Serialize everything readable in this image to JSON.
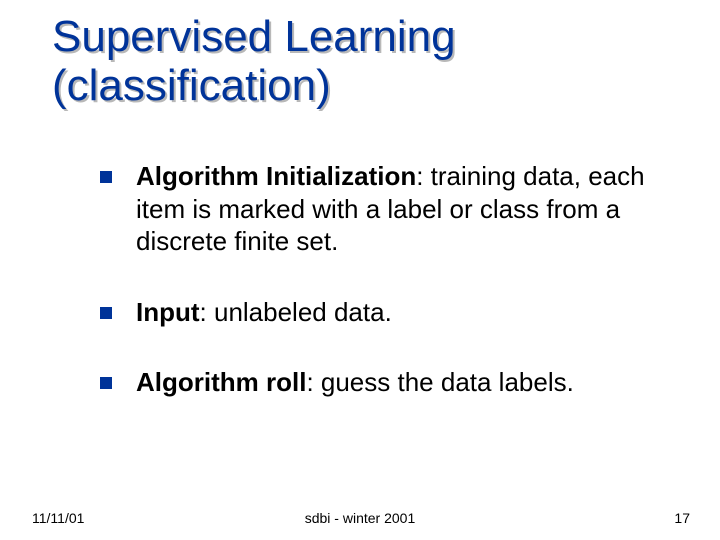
{
  "title_line1": "Supervised Learning",
  "title_line2": "(classification)",
  "bullets": [
    {
      "lead": "Algorithm Initialization",
      "rest": ": training data, each item is marked with a label or class from a discrete finite set."
    },
    {
      "lead": "Input",
      "rest": ": unlabeled data."
    },
    {
      "lead": "Algorithm roll",
      "rest": ": guess the data labels."
    }
  ],
  "footer": {
    "left": "11/11/01",
    "center": "sdbi - winter 2001",
    "right": "17"
  }
}
